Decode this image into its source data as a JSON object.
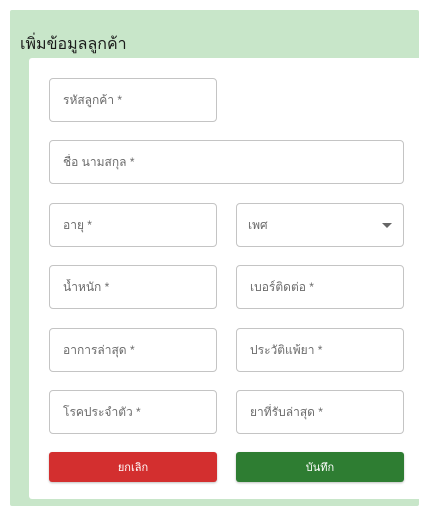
{
  "form": {
    "title": "เพิ่มข้อมูลลูกค้า",
    "fields": {
      "customer_id": {
        "placeholder": "รหัสลูกค้า *"
      },
      "full_name": {
        "placeholder": "ชื่อ นามสกุล *"
      },
      "age": {
        "placeholder": "อายุ *"
      },
      "gender": {
        "label": "เพศ"
      },
      "weight": {
        "placeholder": "น้ำหนัก *"
      },
      "phone": {
        "placeholder": "เบอร์ติดต่อ *"
      },
      "latest_symptoms": {
        "placeholder": "อาการล่าสุด *"
      },
      "allergy_history": {
        "placeholder": "ประวัติแพ้ยา *"
      },
      "chronic_disease": {
        "placeholder": "โรคประจำตัว *"
      },
      "latest_medication": {
        "placeholder": "ยาที่รับล่าสุด *"
      }
    },
    "buttons": {
      "cancel_label": "ยกเลิก",
      "save_label": "บันทึก"
    }
  },
  "colors": {
    "panel_bg": "#c8e6c9",
    "cancel": "#d32f2f",
    "save": "#2e7d32"
  },
  "icons": {
    "gender_dropdown": "caret-down-icon"
  }
}
